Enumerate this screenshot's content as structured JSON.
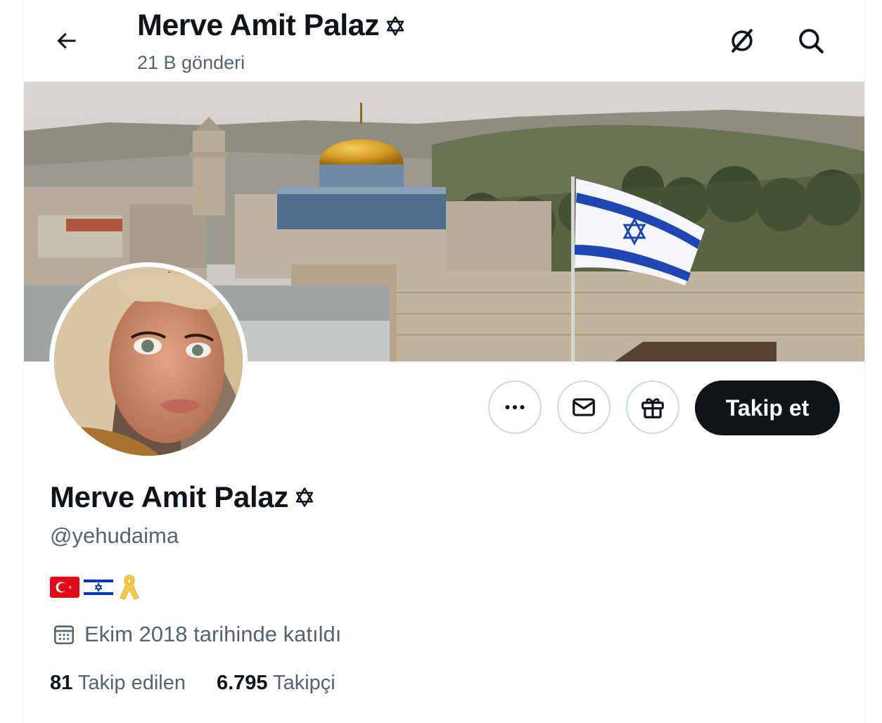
{
  "header": {
    "display_name": "Merve Amit Palaz",
    "posts_count": "21 B gönderi"
  },
  "profile": {
    "display_name": "Merve Amit Palaz",
    "handle": "@yehudaima",
    "bio_emojis": [
      "turkey-flag",
      "israel-flag",
      "yellow-ribbon"
    ],
    "joined": "Ekim 2018 tarihinde katıldı",
    "following_count": "81",
    "following_label": "Takip edilen",
    "followers_count": "6.795",
    "followers_label": "Takipçi"
  },
  "actions": {
    "follow_label": "Takip et",
    "more_icon": "more-icon",
    "message_icon": "mail-icon",
    "gift_icon": "gift-icon"
  },
  "icons": {
    "back": "arrow-left-icon",
    "grok": "grok-icon",
    "search": "search-icon",
    "name_badge": "star-of-david-icon",
    "calendar": "calendar-icon"
  },
  "colors": {
    "text_primary": "#0f1419",
    "text_secondary": "#536471",
    "border": "#cfd9de",
    "follow_bg": "#0f1419",
    "israel_blue": "#0038b8",
    "turkey_red": "#e30a17",
    "ribbon_yellow": "#f7c948"
  }
}
